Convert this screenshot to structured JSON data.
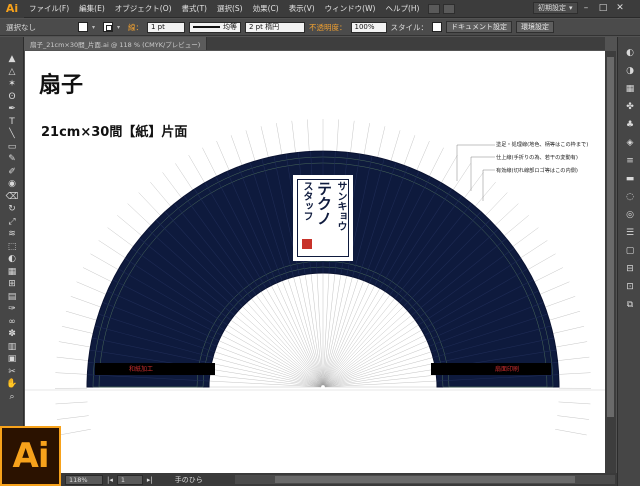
{
  "app": {
    "logo": "Ai",
    "workspace": "初期設定"
  },
  "menu": [
    "ファイル(F)",
    "編集(E)",
    "オブジェクト(O)",
    "書式(T)",
    "選択(S)",
    "効果(C)",
    "表示(V)",
    "ウィンドウ(W)",
    "ヘルプ(H)"
  ],
  "control": {
    "selection": "選択なし",
    "stroke_label": "線：",
    "stroke_weight": "1 pt",
    "profile": "均等",
    "brush": "2 pt 楕円",
    "opacity_label": "不透明度：",
    "opacity_value": "100%",
    "style_label": "スタイル：",
    "doc_setup": "ドキュメント設定",
    "preferences": "環境設定"
  },
  "doctab": {
    "title": "扇子_21cm×30間_片面.ai @ 118 % (CMYK/プレビュー)"
  },
  "artboard": {
    "title": "扇子",
    "subtitle": "21cm×30間【紙】片面",
    "notes": [
      "塗足・処理線(地色、柄等はこの枠まで)",
      "仕上線(手折りの為、若干の変動有)",
      "有効線(切れ線部ロゴ等はこの内側)"
    ],
    "logo_text": [
      "サンキョウ",
      "テクノ",
      "スタッフ"
    ],
    "left_rib_text": "和紙加工",
    "right_rib_text": "扇面印刷"
  },
  "status": {
    "zoom": "118%",
    "page": "1",
    "tool_name": "手のひら"
  },
  "colors": {
    "fan": "#0e1a3d",
    "accent": "#f7a21b",
    "ui_dark": "#464646"
  },
  "tools_left": [
    "selection-tool",
    "direct-selection-tool",
    "magic-wand-tool",
    "lasso-tool",
    "pen-tool",
    "type-tool",
    "line-tool",
    "rectangle-tool",
    "paintbrush-tool",
    "pencil-tool",
    "blob-brush-tool",
    "eraser-tool",
    "rotate-tool",
    "scale-tool",
    "width-tool",
    "free-transform-tool",
    "shape-builder-tool",
    "perspective-grid-tool",
    "mesh-tool",
    "gradient-tool",
    "eyedropper-tool",
    "blend-tool",
    "symbol-sprayer-tool",
    "column-graph-tool",
    "artboard-tool",
    "slice-tool",
    "hand-tool",
    "zoom-tool"
  ],
  "tools_right": [
    "color-panel",
    "color-guide-panel",
    "swatches-panel",
    "brushes-panel",
    "symbols-panel",
    "graphic-styles-panel",
    "stroke-panel",
    "gradient-panel",
    "transparency-panel",
    "appearance-panel",
    "layers-panel",
    "artboards-panel",
    "align-panel",
    "transform-panel",
    "pathfinder-panel"
  ]
}
